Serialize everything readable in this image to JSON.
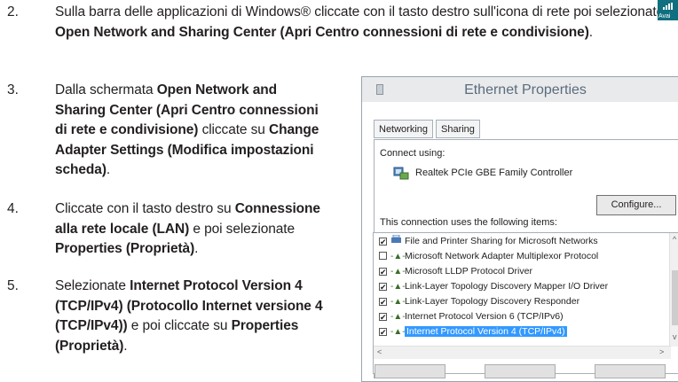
{
  "doc": {
    "step2": {
      "number": "2.",
      "text_a": "Sulla barra delle applicazioni di Windows® cliccate con il tasto destro sull'icona di rete",
      "text_b": " poi selezionate ",
      "bold_b": "Open Network and Sharing Center (Apri Centro connessioni di rete e condivisione)",
      "text_c": "."
    },
    "step3": {
      "number": "3.",
      "text_a": "Dalla schermata ",
      "bold_a": "Open Network and Sharing Center (Apri Centro connessioni di rete e condivisione)",
      "text_b": " cliccate su ",
      "bold_b": "Change Adapter Settings (Modifica impostazioni scheda)",
      "text_c": "."
    },
    "step4": {
      "number": "4.",
      "text_a": "Cliccate con il tasto destro su ",
      "bold_a": "Connessione alla rete locale (LAN)",
      "text_b": " e poi selezionate ",
      "bold_b": "Properties (Proprietà)",
      "text_c": "."
    },
    "step5": {
      "number": "5.",
      "text_a": "Selezionate ",
      "bold_a": "Internet Protocol Version 4 (TCP/IPv4) (Protocollo Internet versione 4 (TCP/IPv4))",
      "text_b": " e poi cliccate su ",
      "bold_b": "Properties (Proprietà)",
      "text_c": "."
    },
    "network_icon_text": "Avai"
  },
  "dialog": {
    "title": "Ethernet Properties",
    "tabs": [
      "Networking",
      "Sharing"
    ],
    "connect_using_label": "Connect using:",
    "adapter_name": "Realtek PCIe GBE Family Controller",
    "configure_label": "Configure...",
    "items_label": "This connection uses the following items:",
    "items": [
      {
        "label": "File and Printer Sharing for Microsoft Networks",
        "checked": true
      },
      {
        "label": "Microsoft Network Adapter Multiplexor Protocol",
        "checked": false
      },
      {
        "label": "Microsoft LLDP Protocol Driver",
        "checked": true
      },
      {
        "label": "Link-Layer Topology Discovery Mapper I/O Driver",
        "checked": true
      },
      {
        "label": "Link-Layer Topology Discovery Responder",
        "checked": true
      },
      {
        "label": "Internet Protocol Version 6 (TCP/IPv6)",
        "checked": true
      },
      {
        "label": "Internet Protocol Version 4 (TCP/IPv4)",
        "checked": true,
        "selected": true
      }
    ]
  }
}
